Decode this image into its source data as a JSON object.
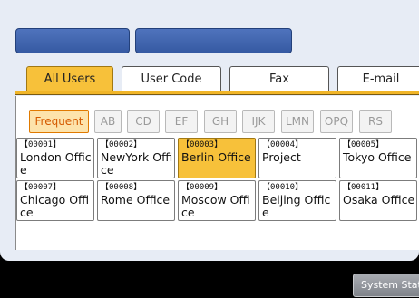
{
  "tabs": [
    {
      "label": "All Users",
      "active": true
    },
    {
      "label": "User Code",
      "active": false
    },
    {
      "label": "Fax",
      "active": false
    },
    {
      "label": "E-mail",
      "active": false
    }
  ],
  "index_keys": [
    "Frequent",
    "AB",
    "CD",
    "EF",
    "GH",
    "IJK",
    "LMN",
    "OPQ",
    "RS"
  ],
  "entries": [
    {
      "number": "【00001】",
      "name": "London Office",
      "selected": false
    },
    {
      "number": "【00002】",
      "name": "NewYork Office",
      "selected": false
    },
    {
      "number": "【00003】",
      "name": "Berlin Office",
      "selected": true
    },
    {
      "number": "【00004】",
      "name": "Project",
      "selected": false
    },
    {
      "number": "【00005】",
      "name": "Tokyo Office",
      "selected": false
    },
    {
      "number": "【00007】",
      "name": "Chicago Office",
      "selected": false
    },
    {
      "number": "【00008】",
      "name": "Rome Office",
      "selected": false
    },
    {
      "number": "【00009】",
      "name": "Moscow Office",
      "selected": false
    },
    {
      "number": "【00010】",
      "name": "Beijing Office",
      "selected": false
    },
    {
      "number": "【00011】",
      "name": "Osaka Office",
      "selected": false
    }
  ],
  "status_button": {
    "label": "System Status"
  },
  "colors": {
    "accent": "#f7c13a",
    "blue_button": "#4167b3",
    "active_index": "#e07a00"
  }
}
